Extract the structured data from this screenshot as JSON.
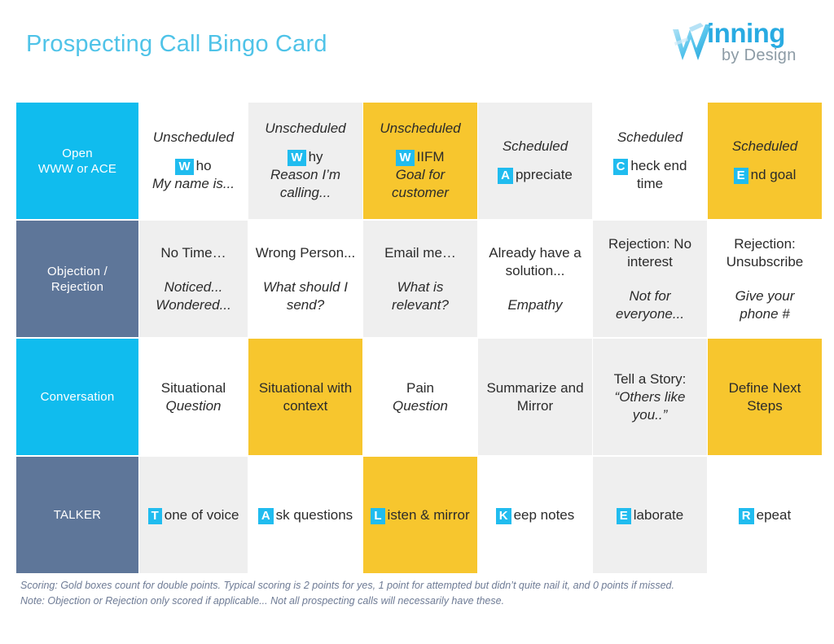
{
  "header": {
    "title": "Prospecting Call Bingo Card",
    "logo_word": "inning",
    "logo_sub": "by Design",
    "logo_mark": "w-logo-icon"
  },
  "colors": {
    "cyan": "#10BCEE",
    "slate": "#5E7699",
    "gold": "#F7C62E",
    "gray": "#EFEFEF",
    "white": "#FFFFFF",
    "title": "#4FC3E8",
    "footer": "#6E7B95"
  },
  "rows": [
    {
      "category": "Open\nWWW or ACE",
      "category_line1": "Open",
      "category_line2": "WWW or ACE",
      "category_style": "cyan",
      "cells": [
        {
          "bg": "white",
          "tag": "Unscheduled",
          "badge": "W",
          "main": "ho",
          "sub": "My name is...",
          "gold": false
        },
        {
          "bg": "gray",
          "tag": "Unscheduled",
          "badge": "W",
          "main": "hy",
          "sub": "Reason I’m calling...",
          "gold": false
        },
        {
          "bg": "gold",
          "tag": "Unscheduled",
          "badge": "W",
          "main": "IIFM",
          "sub": "Goal for customer",
          "gold": true
        },
        {
          "bg": "gray",
          "tag": "Scheduled",
          "badge": "A",
          "main": "ppreciate",
          "sub": "",
          "gold": false
        },
        {
          "bg": "white",
          "tag": "Scheduled",
          "badge": "C",
          "main": "heck end time",
          "sub": "",
          "gold": false
        },
        {
          "bg": "gold",
          "tag": "Scheduled",
          "badge": "E",
          "main": "nd goal",
          "sub": "",
          "gold": true
        }
      ]
    },
    {
      "category": "Objection /\nRejection",
      "category_line1": "Objection /",
      "category_line2": "Rejection",
      "category_style": "slate",
      "cells": [
        {
          "bg": "gray",
          "tag": "",
          "badge": "",
          "main": "No Time…",
          "sub": "Noticed... Wondered...",
          "gold": false
        },
        {
          "bg": "white",
          "tag": "",
          "badge": "",
          "main": "Wrong Person...",
          "sub": "What should I send?",
          "gold": false
        },
        {
          "bg": "gray",
          "tag": "",
          "badge": "",
          "main": "Email me…",
          "sub": "What is relevant?",
          "gold": false
        },
        {
          "bg": "white",
          "tag": "",
          "badge": "",
          "main": "Already have a solution...",
          "sub": "Empathy",
          "gold": false
        },
        {
          "bg": "gray",
          "tag": "",
          "badge": "",
          "main": "Rejection: No interest",
          "sub": "Not for everyone...",
          "gold": false
        },
        {
          "bg": "white",
          "tag": "",
          "badge": "",
          "main": "Rejection: Unsubscribe",
          "sub": "Give your phone #",
          "gold": false
        }
      ]
    },
    {
      "category": "Conversation",
      "category_line1": "Conversation",
      "category_line2": "",
      "category_style": "cyan",
      "cells": [
        {
          "bg": "white",
          "tag": "",
          "badge": "",
          "main": "Situational",
          "sub": "Question",
          "gold": false
        },
        {
          "bg": "gold",
          "tag": "",
          "badge": "",
          "main": "Situational with context",
          "sub": "",
          "gold": true
        },
        {
          "bg": "white",
          "tag": "",
          "badge": "",
          "main": "Pain",
          "sub": "Question",
          "gold": false
        },
        {
          "bg": "gray",
          "tag": "",
          "badge": "",
          "main": "Summarize and Mirror",
          "sub": "",
          "gold": false
        },
        {
          "bg": "gray",
          "tag": "",
          "badge": "",
          "main": "Tell a Story:",
          "sub": "“Others like you..”",
          "gold": false
        },
        {
          "bg": "gold",
          "tag": "",
          "badge": "",
          "main": "Define Next Steps",
          "sub": "",
          "gold": true
        }
      ]
    },
    {
      "category": "TALKER",
      "category_line1": "TALKER",
      "category_line2": "",
      "category_style": "slate",
      "cells": [
        {
          "bg": "gray",
          "tag": "",
          "badge": "T",
          "main": "one of voice",
          "sub": "",
          "gold": false
        },
        {
          "bg": "white",
          "tag": "",
          "badge": "A",
          "main": "sk questions",
          "sub": "",
          "gold": false
        },
        {
          "bg": "gold",
          "tag": "",
          "badge": "L",
          "main": "isten & mirror",
          "sub": "",
          "gold": true
        },
        {
          "bg": "white",
          "tag": "",
          "badge": "K",
          "main": "eep notes",
          "sub": "",
          "gold": false
        },
        {
          "bg": "gray",
          "tag": "",
          "badge": "E",
          "main": "laborate",
          "sub": "",
          "gold": false
        },
        {
          "bg": "white",
          "tag": "",
          "badge": "R",
          "main": "epeat",
          "sub": "",
          "gold": false
        }
      ]
    }
  ],
  "footer": {
    "line1": "Scoring: Gold boxes count for double points. Typical scoring is 2 points for yes, 1 point for attempted but didn’t quite nail it, and 0 points if missed.",
    "line2": "Note: Objection or Rejection only scored if applicable... Not all prospecting calls will necessarily have these."
  }
}
